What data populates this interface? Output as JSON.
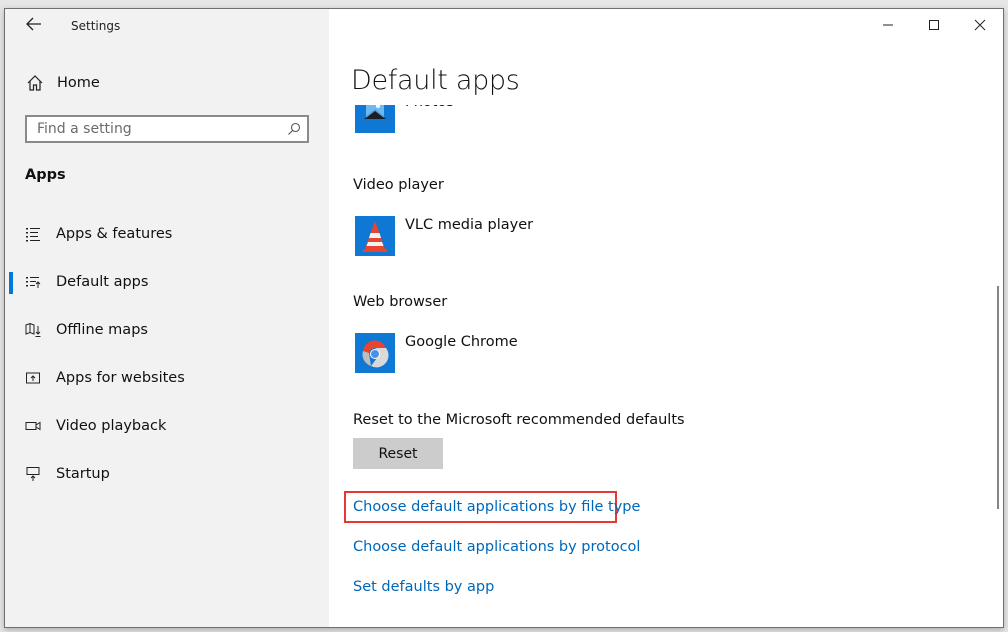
{
  "window": {
    "title": "Settings",
    "controls": [
      "minimize",
      "maximize",
      "close"
    ]
  },
  "sidebar": {
    "back_icon": "arrow-left-icon",
    "home_label": "Home",
    "search_placeholder": "Find a setting",
    "section_title": "Apps",
    "items": [
      {
        "label": "Apps & features",
        "icon": "list-icon",
        "active": false
      },
      {
        "label": "Default apps",
        "icon": "default-apps-icon",
        "active": true
      },
      {
        "label": "Offline maps",
        "icon": "map-download-icon",
        "active": false
      },
      {
        "label": "Apps for websites",
        "icon": "app-website-icon",
        "active": false
      },
      {
        "label": "Video playback",
        "icon": "video-camera-icon",
        "active": false
      },
      {
        "label": "Startup",
        "icon": "startup-icon",
        "active": false
      }
    ],
    "accent_color": "#0078d7"
  },
  "main": {
    "page_title": "Default apps",
    "photo_viewer": {
      "app": "Photos"
    },
    "video_player": {
      "label": "Video player",
      "app": "VLC media player"
    },
    "web_browser": {
      "label": "Web browser",
      "app": "Google Chrome"
    },
    "reset": {
      "label": "Reset to the Microsoft recommended defaults",
      "button": "Reset"
    },
    "links": [
      {
        "label": "Choose default applications by file type",
        "highlighted": true
      },
      {
        "label": "Choose default applications by protocol",
        "highlighted": false
      },
      {
        "label": "Set defaults by app",
        "highlighted": false
      }
    ],
    "link_color": "#0067b8",
    "highlight_color": "#e53935"
  }
}
